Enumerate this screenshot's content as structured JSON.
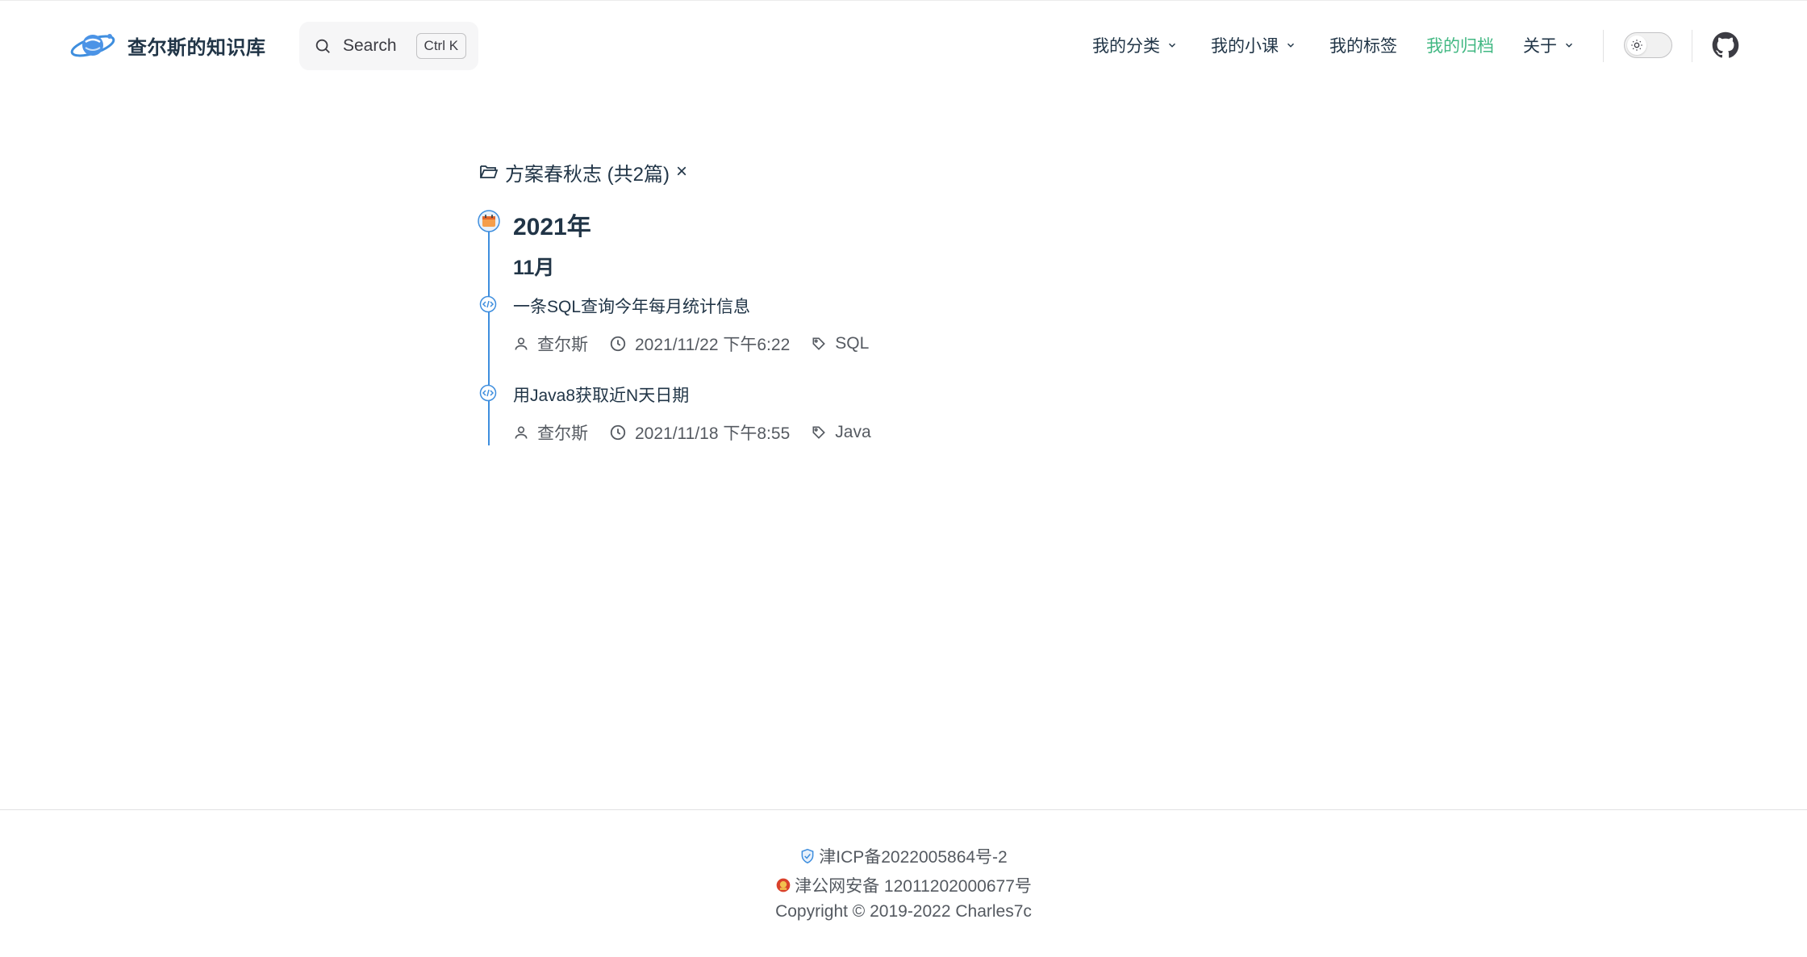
{
  "site": {
    "title": "查尔斯的知识库"
  },
  "search": {
    "label": "Search",
    "shortcut": "Ctrl K"
  },
  "nav": {
    "items": [
      {
        "label": "我的分类",
        "dropdown": true
      },
      {
        "label": "我的小课",
        "dropdown": true
      },
      {
        "label": "我的标签",
        "dropdown": false
      },
      {
        "label": "我的归档",
        "dropdown": false,
        "active": true
      },
      {
        "label": "关于",
        "dropdown": true
      }
    ]
  },
  "filter": {
    "label": "方案春秋志 (共2篇)",
    "close": "×"
  },
  "archive": {
    "year": "2021年",
    "month": "11月",
    "articles": [
      {
        "title": "一条SQL查询今年每月统计信息",
        "author": "查尔斯",
        "date": "2021/11/22 下午6:22",
        "tag": "SQL"
      },
      {
        "title": "用Java8获取近N天日期",
        "author": "查尔斯",
        "date": "2021/11/18 下午8:55",
        "tag": "Java"
      }
    ]
  },
  "footer": {
    "icp": "津ICP备2022005864号-2",
    "police": "津公网安备 12011202000677号",
    "copyright": "Copyright © 2019-2022 Charles7c"
  },
  "colors": {
    "accent": "#42b883",
    "timeline": "#3e8ede",
    "text": "#213547"
  }
}
